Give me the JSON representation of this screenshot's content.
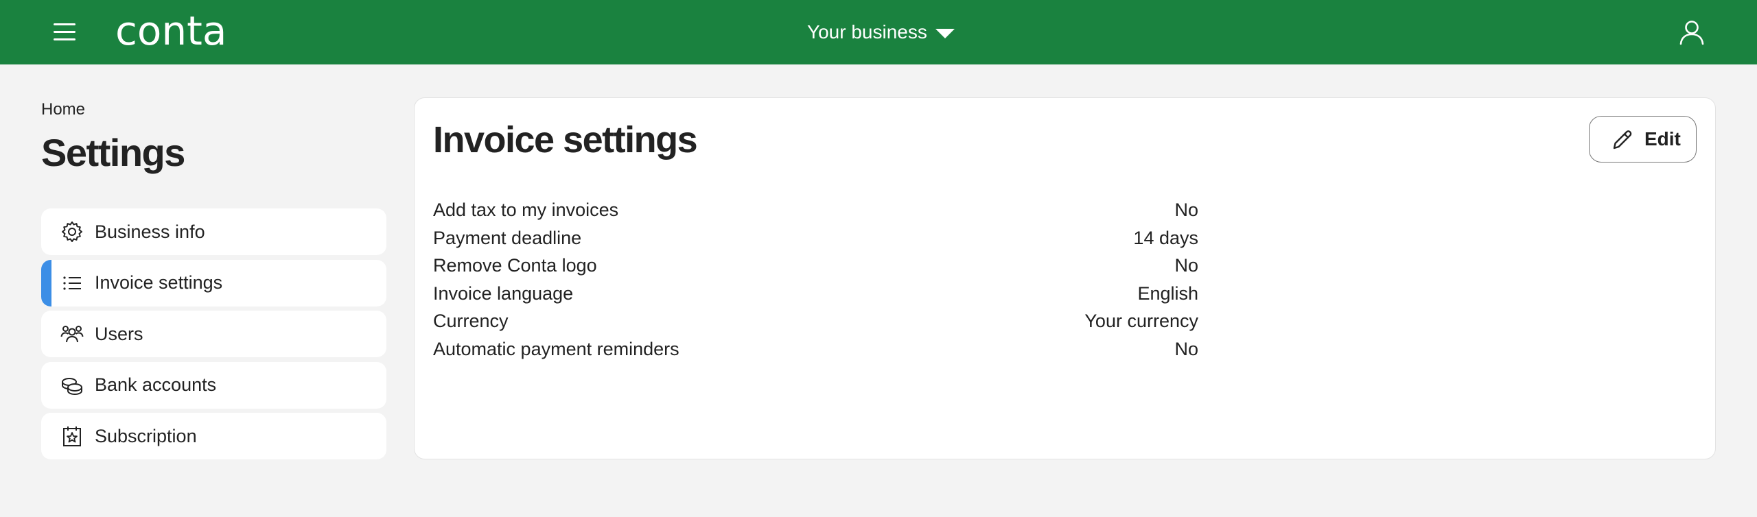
{
  "header": {
    "logo_text": "conta",
    "business_selector": "Your business",
    "brand_color": "#1a823f"
  },
  "breadcrumb": "Home",
  "page_title": "Settings",
  "nav": {
    "items": [
      {
        "label": "Business info",
        "icon": "gear-icon",
        "active": false
      },
      {
        "label": "Invoice settings",
        "icon": "list-icon",
        "active": true
      },
      {
        "label": "Users",
        "icon": "users-icon",
        "active": false
      },
      {
        "label": "Bank accounts",
        "icon": "coins-icon",
        "active": false
      },
      {
        "label": "Subscription",
        "icon": "calendar-star-icon",
        "active": false
      }
    ],
    "active_color": "#3c8ee6"
  },
  "card": {
    "title": "Invoice settings",
    "edit_label": "Edit",
    "settings": [
      {
        "key": "Add tax to my invoices",
        "value": "No"
      },
      {
        "key": "Payment deadline",
        "value": "14 days"
      },
      {
        "key": "Remove Conta logo",
        "value": "No"
      },
      {
        "key": "Invoice language",
        "value": "English"
      },
      {
        "key": "Currency",
        "value": "Your currency"
      },
      {
        "key": "Automatic payment reminders",
        "value": "No"
      }
    ]
  }
}
